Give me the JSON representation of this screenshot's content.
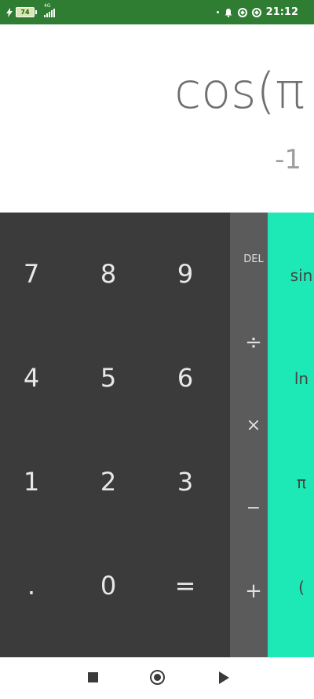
{
  "status_bar": {
    "battery_level": "74",
    "network_type": "4G",
    "time": "21:12",
    "icons": [
      "charging-bolt-icon",
      "battery-icon",
      "signal-icon",
      "bell-icon",
      "sync-icon",
      "data-saver-icon"
    ]
  },
  "display": {
    "formula": "cos(π",
    "result": "-1"
  },
  "numpad": {
    "keys": [
      "7",
      "8",
      "9",
      "4",
      "5",
      "6",
      "1",
      "2",
      "3",
      ".",
      "0",
      "="
    ]
  },
  "operators": {
    "delete": "DEL",
    "divide": "÷",
    "multiply": "×",
    "subtract": "−",
    "add": "+"
  },
  "advanced": {
    "sin": "sin",
    "ln": "ln",
    "pi": "π",
    "paren": "("
  },
  "colors": {
    "status_bar": "#2e7d32",
    "numpad": "#3b3b3b",
    "operators": "#5b5b5b",
    "advanced": "#1de9b6",
    "formula_text": "#6f6f6f"
  }
}
